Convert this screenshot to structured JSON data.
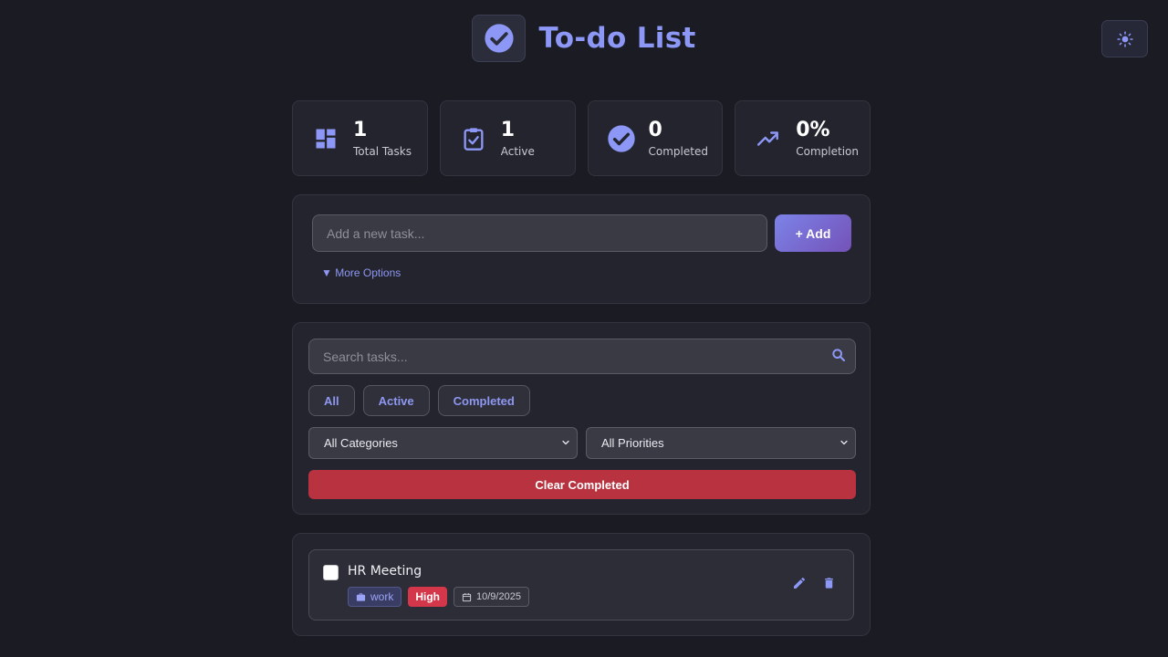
{
  "app": {
    "title": "To-do List",
    "accent_color": "#8c97f6",
    "logo_icon": "check-circle-icon",
    "theme_toggle_icon": "sun-icon"
  },
  "stats": [
    {
      "icon": "dashboard-icon",
      "value": "1",
      "label": "Total Tasks"
    },
    {
      "icon": "clipboard-check-icon",
      "value": "1",
      "label": "Active"
    },
    {
      "icon": "check-circle-icon",
      "value": "0",
      "label": "Completed"
    },
    {
      "icon": "trending-up-icon",
      "value": "0%",
      "label": "Completion"
    }
  ],
  "add_task": {
    "placeholder": "Add a new task...",
    "value": "",
    "add_label": "+ Add",
    "more_options_label": "▼ More Options"
  },
  "filters": {
    "search_placeholder": "Search tasks...",
    "search_value": "",
    "buttons": [
      "All",
      "Active",
      "Completed"
    ],
    "category_selected": "All Categories",
    "priority_selected": "All Priorities",
    "clear_label": "Clear Completed",
    "clear_color": "#b9323f"
  },
  "tasks": [
    {
      "title": "HR Meeting",
      "completed": false,
      "category": "work",
      "category_icon": "briefcase-icon",
      "priority": "High",
      "priority_color": "#d5374a",
      "date": "10/9/2025",
      "date_icon": "calendar-icon"
    }
  ]
}
